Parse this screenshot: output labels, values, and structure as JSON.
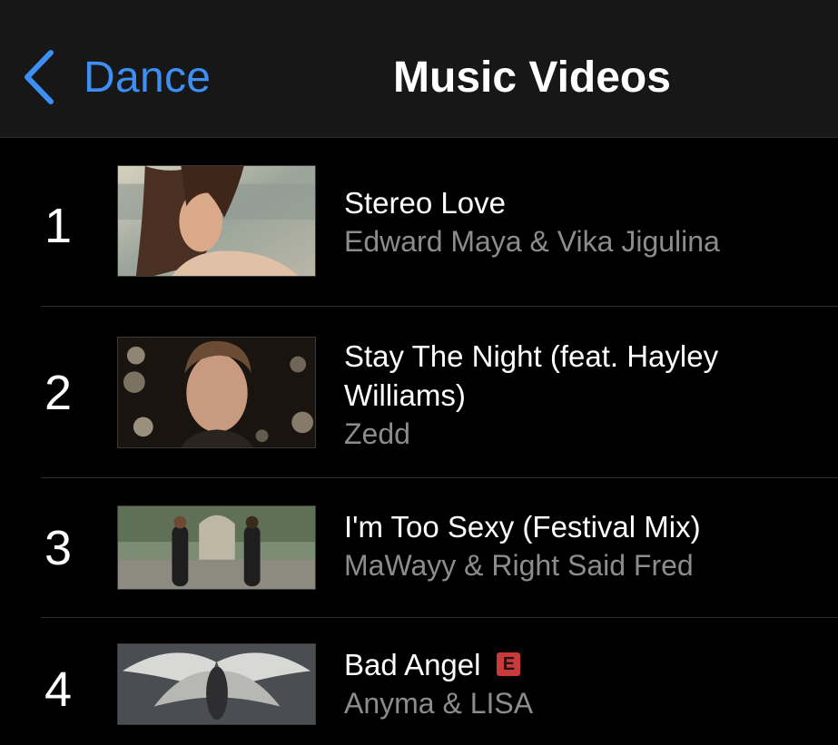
{
  "nav": {
    "back_label": "Dance",
    "title": "Music Videos"
  },
  "videos": [
    {
      "rank": "1",
      "title": "Stereo Love",
      "artist": "Edward Maya & Vika Jigulina",
      "explicit": false
    },
    {
      "rank": "2",
      "title": "Stay The Night (feat. Hayley Williams)",
      "artist": "Zedd",
      "explicit": false
    },
    {
      "rank": "3",
      "title": "I'm Too Sexy (Festival Mix)",
      "artist": "MaWayy & Right Said Fred",
      "explicit": false
    },
    {
      "rank": "4",
      "title": "Bad Angel",
      "artist": "Anyma & LISA",
      "explicit": true,
      "explicit_badge": "E"
    }
  ],
  "colors": {
    "accent": "#3d8ef5",
    "navbar_bg": "#171717",
    "background": "#000000",
    "secondary_text": "#8c8c8e",
    "explicit_badge": "#c93a3a"
  },
  "icons": {
    "back": "chevron-left-icon"
  }
}
